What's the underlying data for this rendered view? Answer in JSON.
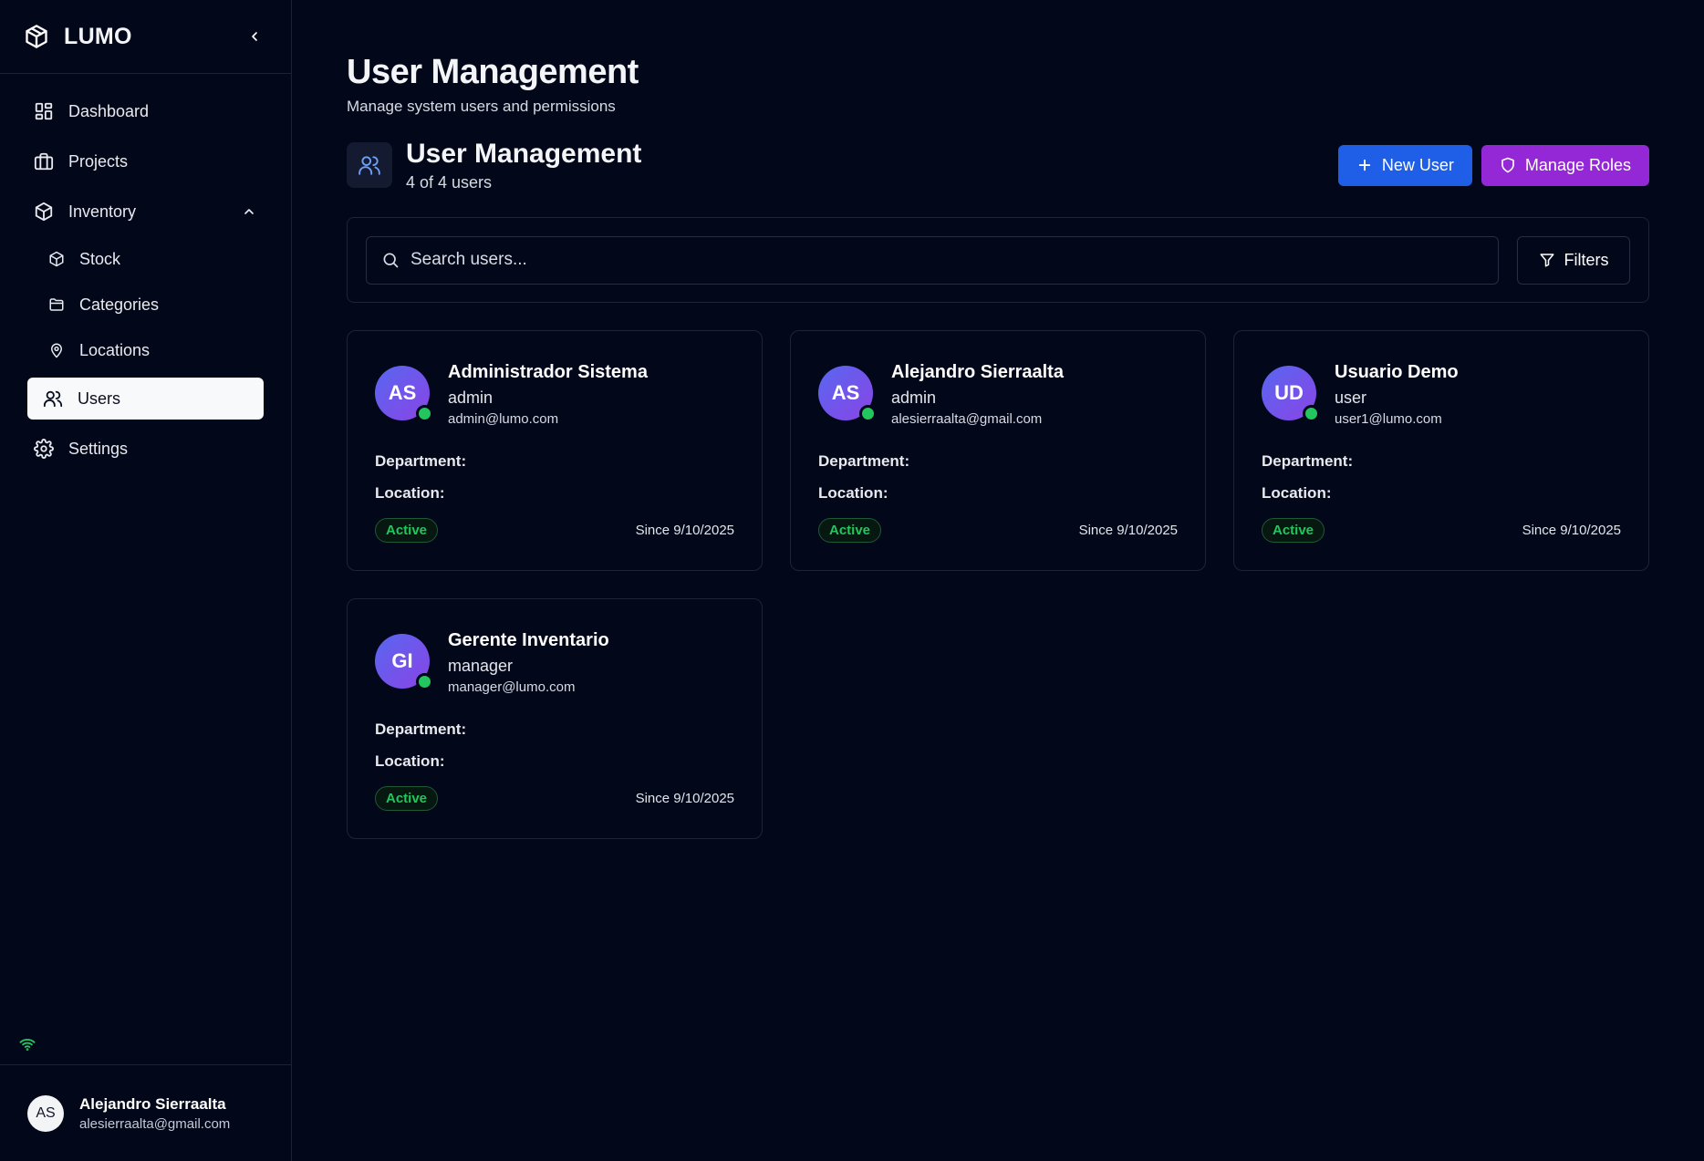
{
  "brand": {
    "name": "LUMO"
  },
  "nav": {
    "dashboard": "Dashboard",
    "projects": "Projects",
    "inventory": "Inventory",
    "stock": "Stock",
    "categories": "Categories",
    "locations": "Locations",
    "users": "Users",
    "settings": "Settings"
  },
  "profile": {
    "initials": "AS",
    "name": "Alejandro Sierraalta",
    "email": "alesierraalta@gmail.com"
  },
  "header": {
    "title": "User Management",
    "subtitle": "Manage system users and permissions"
  },
  "section": {
    "title": "User Management",
    "count": "4 of 4 users",
    "new_user": "New User",
    "manage_roles": "Manage Roles"
  },
  "search": {
    "placeholder": "Search users...",
    "value": "",
    "filters": "Filters"
  },
  "labels": {
    "department": "Department:",
    "location": "Location:"
  },
  "users": [
    {
      "initials": "AS",
      "name": "Administrador Sistema",
      "role": "admin",
      "email": "admin@lumo.com",
      "status": "Active",
      "since": "Since 9/10/2025"
    },
    {
      "initials": "AS",
      "name": "Alejandro Sierraalta",
      "role": "admin",
      "email": "alesierraalta@gmail.com",
      "status": "Active",
      "since": "Since 9/10/2025"
    },
    {
      "initials": "UD",
      "name": "Usuario Demo",
      "role": "user",
      "email": "user1@lumo.com",
      "status": "Active",
      "since": "Since 9/10/2025"
    },
    {
      "initials": "GI",
      "name": "Gerente Inventario",
      "role": "manager",
      "email": "manager@lumo.com",
      "status": "Active",
      "since": "Since 9/10/2025"
    }
  ],
  "icons": {
    "logo": "box-icon",
    "collapse": "chevron-left-icon",
    "dashboard": "layout-grid-icon",
    "projects": "briefcase-icon",
    "inventory": "package-icon",
    "stock": "package-icon",
    "categories": "folder-icon",
    "locations": "map-pin-icon",
    "users": "users-icon",
    "settings": "gear-icon",
    "wifi": "wifi-icon",
    "search": "search-icon",
    "filters": "filter-icon",
    "new_user": "plus-icon",
    "manage_roles": "shield-icon"
  },
  "colors": {
    "background": "#03071a",
    "primary_button": "#1f5fe8",
    "roles_button": "#9427d6",
    "status_active": "#22c55e",
    "avatar_gradient_start": "#5867f0",
    "avatar_gradient_end": "#8a44e6"
  }
}
